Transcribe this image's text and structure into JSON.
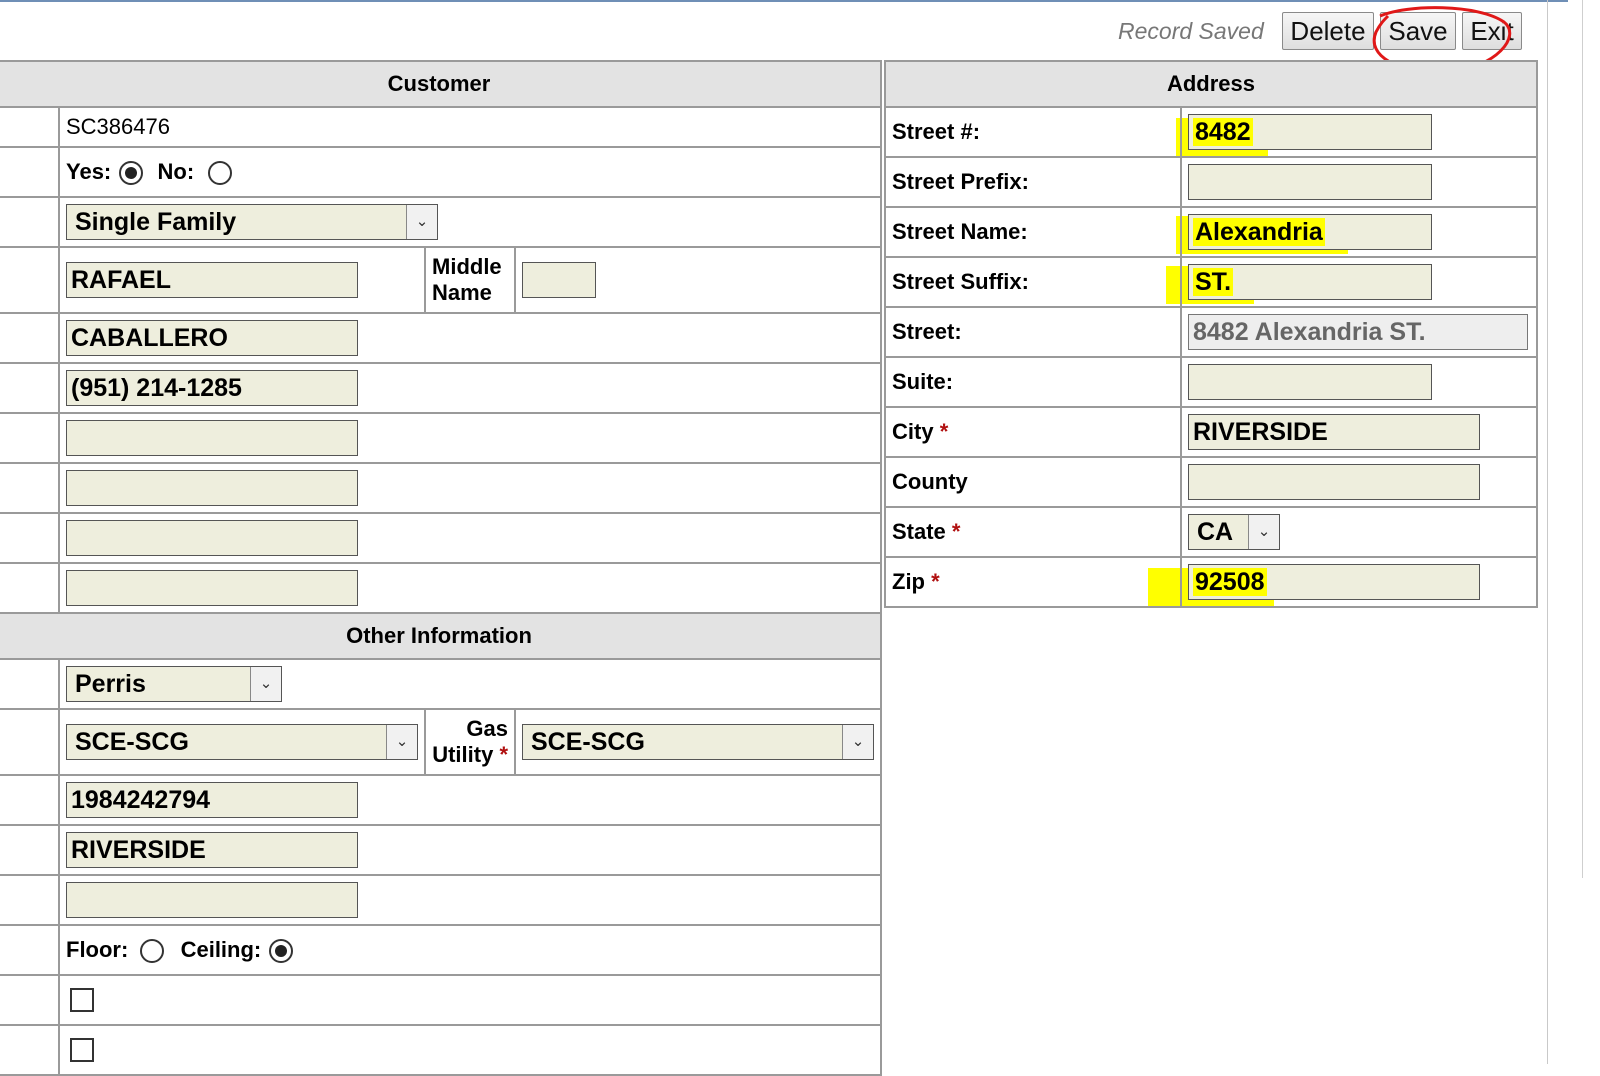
{
  "toolbar": {
    "status": "Record Saved",
    "delete_label": "Delete",
    "save_label": "Save",
    "exit_label": "Exit"
  },
  "customer": {
    "header": "Customer",
    "id": "SC386476",
    "yes_label": "Yes:",
    "no_label": "No:",
    "type": "Single Family",
    "first_name": "RAFAEL",
    "middle_name_label": "Middle Name",
    "middle_name": "",
    "last_name": "CABALLERO",
    "phone": "(951) 214-1285",
    "blank1": "",
    "blank2": "",
    "blank3": "",
    "blank4": ""
  },
  "other": {
    "header": "Other Information",
    "location": "Perris",
    "electric_utility": "SCE-SCG",
    "gas_utility_label": "Gas Utility",
    "gas_utility": "SCE-SCG",
    "account": "1984242794",
    "city": "RIVERSIDE",
    "blank": "",
    "floor_label": "Floor:",
    "ceiling_label": "Ceiling:"
  },
  "address": {
    "header": "Address",
    "street_num_label": "Street #:",
    "street_num": "8482",
    "street_prefix_label": "Street Prefix:",
    "street_prefix": "",
    "street_name_label": "Street Name:",
    "street_name": "Alexandria",
    "street_suffix_label": "Street Suffix:",
    "street_suffix": "ST.",
    "street_label": "Street:",
    "street": "8482  Alexandria ST.",
    "suite_label": "Suite:",
    "suite": "",
    "city_label": "City",
    "city": "RIVERSIDE",
    "county_label": "County",
    "county": "",
    "state_label": "State",
    "state": "CA",
    "zip_label": "Zip",
    "zip": "92508",
    "required_mark": "*"
  },
  "colors": {
    "highlight": "#ffff00",
    "annotation": "#e01818",
    "input_bg": "#eeeedd",
    "header_bg": "#e3e3e3"
  }
}
